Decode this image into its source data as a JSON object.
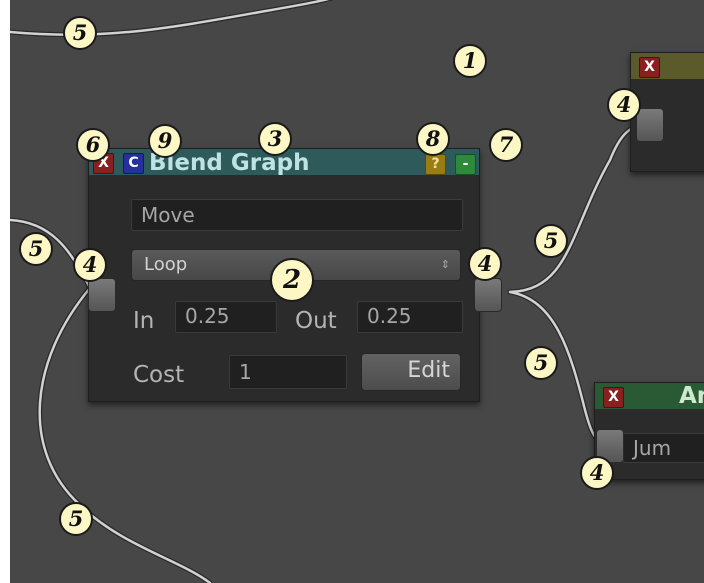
{
  "blend_node": {
    "title": "Blend Graph",
    "close_glyph": "X",
    "c_glyph": "C",
    "help_glyph": "?",
    "collapse_glyph": "-",
    "name_value": "Move",
    "mode_value": "Loop",
    "mode_arrow": "⇕",
    "in_label": "In",
    "in_value": "0.25",
    "out_label": "Out",
    "out_value": "0.25",
    "cost_label": "Cost",
    "cost_value": "1",
    "edit_label": "Edit"
  },
  "top_right_node": {
    "close_glyph": "X"
  },
  "bottom_right_node": {
    "close_glyph": "X",
    "title_fragment": "An",
    "field_fragment": "Jum"
  },
  "callouts": {
    "canvas": "1",
    "dropdown": "2",
    "title": "3",
    "port": "4",
    "connection": "5",
    "close": "6",
    "collapse": "7",
    "help": "8",
    "c_button": "9"
  },
  "colors": {
    "canvas_bg": "#474747",
    "node_bg": "#2b2b2b",
    "header_teal": "#2f5a5c",
    "header_olive": "#5a5a2a",
    "header_green": "#2a5a34",
    "callout_fill": "#fdf7c6"
  }
}
